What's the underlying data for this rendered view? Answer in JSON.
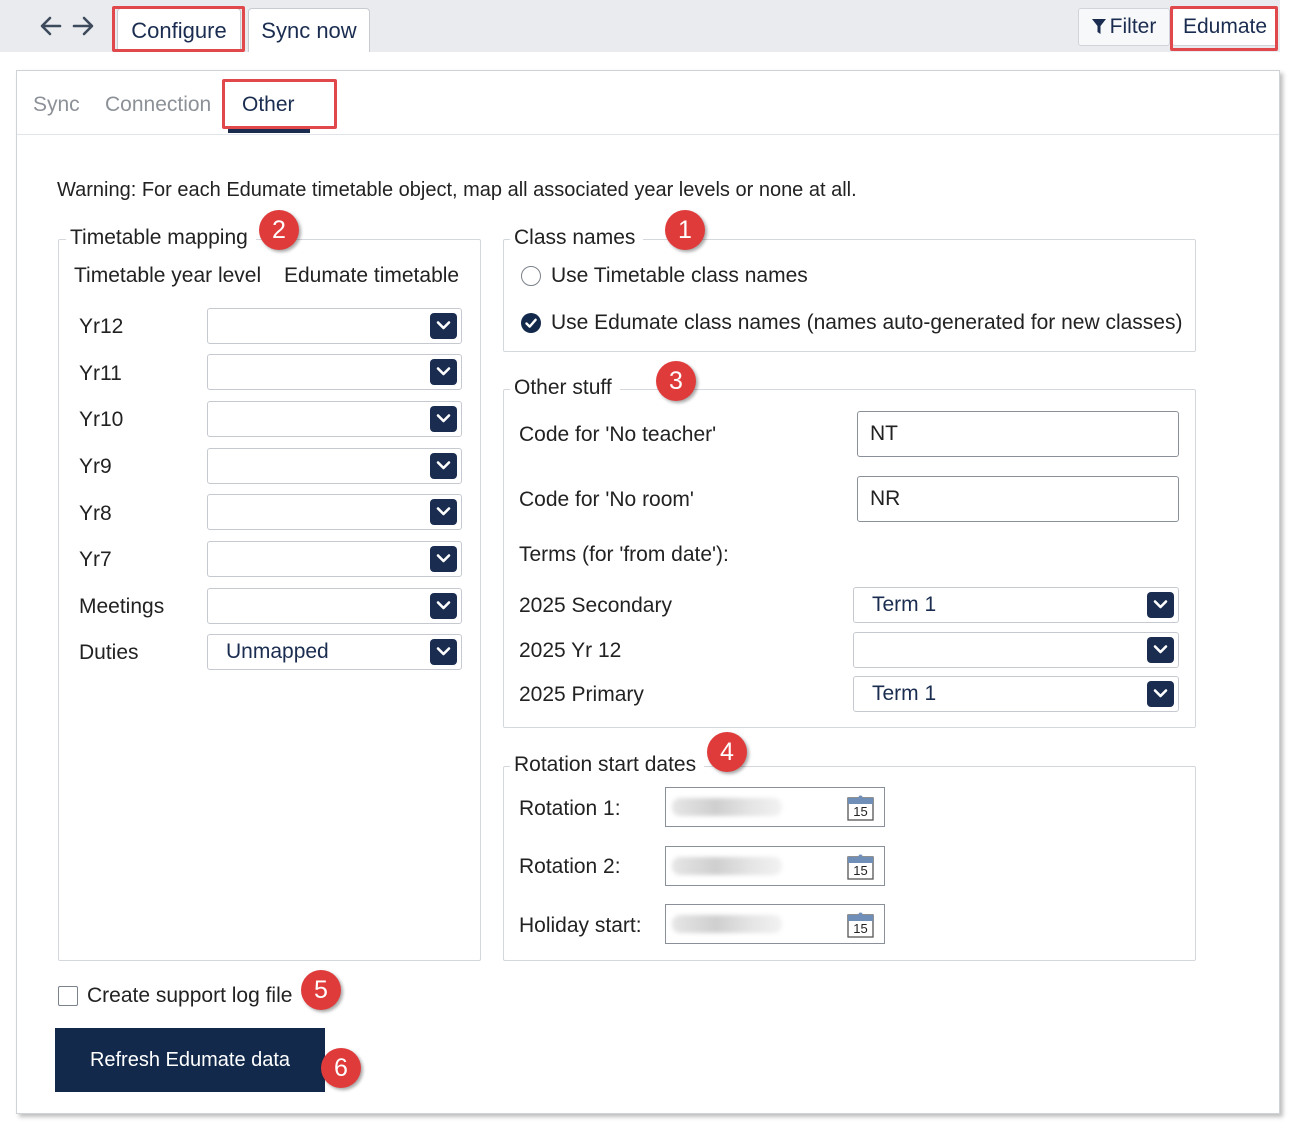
{
  "topbar": {
    "back_icon": "arrow-left-icon",
    "forward_icon": "arrow-right-icon",
    "tabs": [
      {
        "label": "Configure"
      },
      {
        "label": "Sync now"
      }
    ],
    "filter_label": "Filter",
    "filter_icon": "filter-icon",
    "edumate_label": "Edumate"
  },
  "subtabs": [
    {
      "label": "Sync"
    },
    {
      "label": "Connection"
    },
    {
      "label": "Other"
    }
  ],
  "warning": "Warning: For each Edumate timetable object, map all associated year levels or none at all.",
  "timetable_mapping": {
    "legend": "Timetable mapping",
    "col_year": "Timetable year level",
    "col_timetable": "Edumate timetable",
    "rows": [
      {
        "label": "Yr12",
        "value": ""
      },
      {
        "label": "Yr11",
        "value": ""
      },
      {
        "label": "Yr10",
        "value": ""
      },
      {
        "label": "Yr9",
        "value": ""
      },
      {
        "label": "Yr8",
        "value": ""
      },
      {
        "label": "Yr7",
        "value": ""
      },
      {
        "label": "Meetings",
        "value": ""
      },
      {
        "label": "Duties",
        "value": "Unmapped"
      }
    ]
  },
  "class_names": {
    "legend": "Class names",
    "options": [
      {
        "label": "Use Timetable class names",
        "checked": false
      },
      {
        "label": "Use Edumate class names (names auto-generated for new classes)",
        "checked": true
      }
    ]
  },
  "other_stuff": {
    "legend": "Other stuff",
    "no_teacher_label": "Code for 'No teacher'",
    "no_teacher_value": "NT",
    "no_room_label": "Code for 'No room'",
    "no_room_value": "NR",
    "terms_label": "Terms (for 'from date'):",
    "terms": [
      {
        "label": "2025 Secondary",
        "value": "Term 1"
      },
      {
        "label": "2025 Yr 12",
        "value": ""
      },
      {
        "label": "2025 Primary",
        "value": "Term 1"
      }
    ]
  },
  "rotation": {
    "legend": "Rotation start dates",
    "rows": [
      {
        "label": "Rotation 1:"
      },
      {
        "label": "Rotation 2:"
      },
      {
        "label": "Holiday start:"
      }
    ],
    "calendar_icon": "calendar-icon",
    "calendar_day": "15"
  },
  "support_log": {
    "label": "Create support log file",
    "checked": false
  },
  "refresh_label": "Refresh Edumate data",
  "badges": [
    "1",
    "2",
    "3",
    "4",
    "5",
    "6"
  ],
  "colors": {
    "navy": "#13294b",
    "highlight": "#e0484b",
    "badge": "#e03b3b"
  }
}
